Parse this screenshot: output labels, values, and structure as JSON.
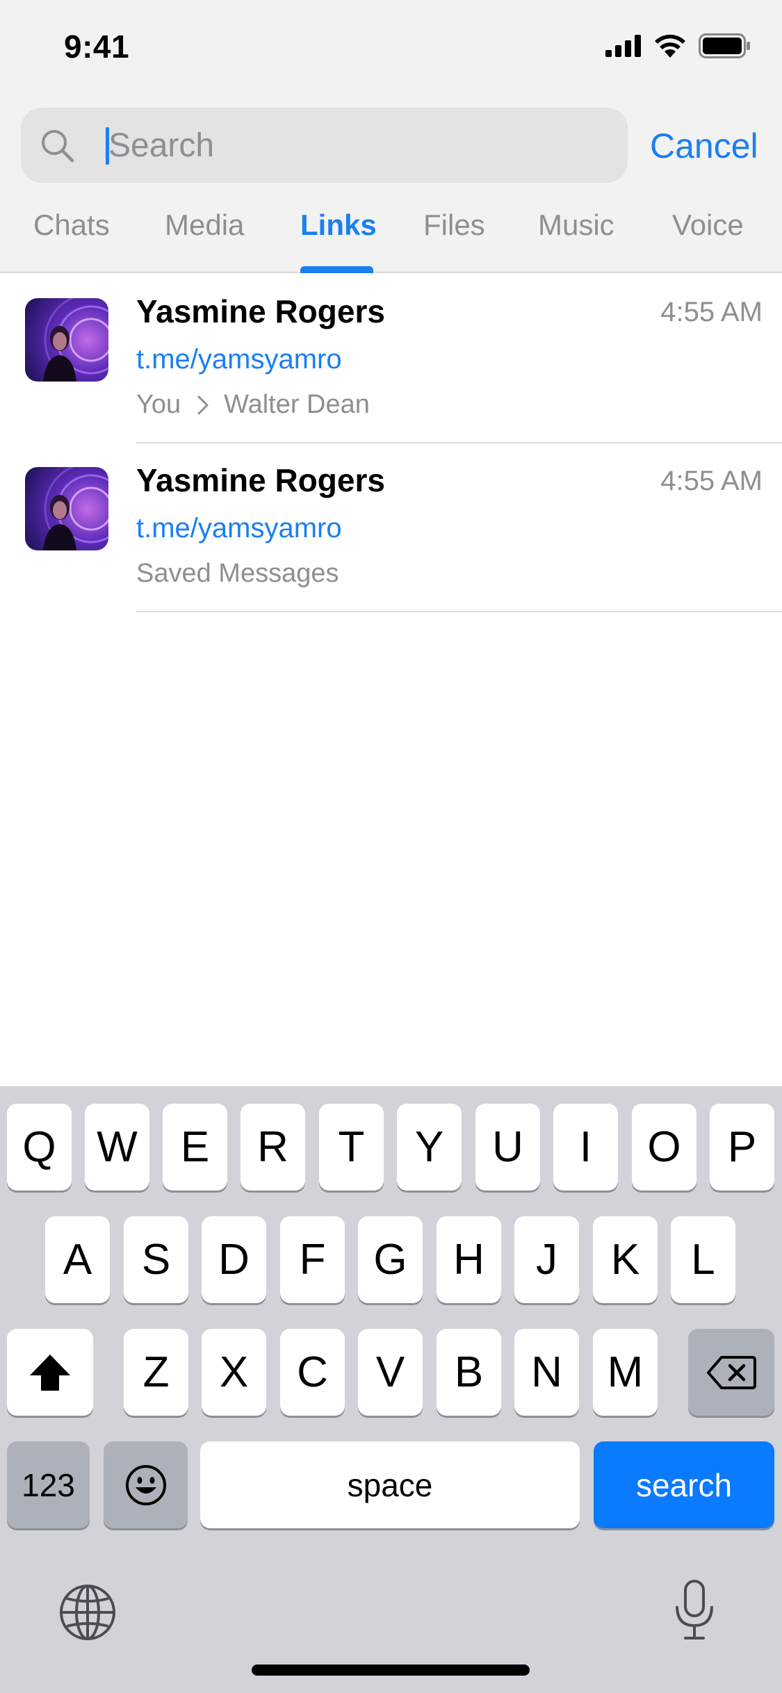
{
  "status_bar": {
    "time": "9:41"
  },
  "search": {
    "placeholder": "Search",
    "value": "",
    "cancel_label": "Cancel"
  },
  "tabs": [
    {
      "label": "Chats",
      "active": false
    },
    {
      "label": "Media",
      "active": false
    },
    {
      "label": "Links",
      "active": true
    },
    {
      "label": "Files",
      "active": false
    },
    {
      "label": "Music",
      "active": false
    },
    {
      "label": "Voice",
      "active": false
    }
  ],
  "results": [
    {
      "name": "Yasmine Rogers",
      "time": "4:55 AM",
      "link": "t.me/yamsyamro",
      "from": "You",
      "to": "Walter Dean"
    },
    {
      "name": "Yasmine Rogers",
      "time": "4:55 AM",
      "link": "t.me/yamsyamro",
      "chat": "Saved Messages"
    }
  ],
  "keyboard": {
    "row1": [
      "Q",
      "W",
      "E",
      "R",
      "T",
      "Y",
      "U",
      "I",
      "O",
      "P"
    ],
    "row2": [
      "A",
      "S",
      "D",
      "F",
      "G",
      "H",
      "J",
      "K",
      "L"
    ],
    "row3": [
      "Z",
      "X",
      "C",
      "V",
      "B",
      "N",
      "M"
    ],
    "numbers_label": "123",
    "space_label": "space",
    "return_label": "search"
  },
  "colors": {
    "accent": "#1a7ff1",
    "return_key": "#0a7aff",
    "keyboard_bg": "#d1d3d9"
  }
}
